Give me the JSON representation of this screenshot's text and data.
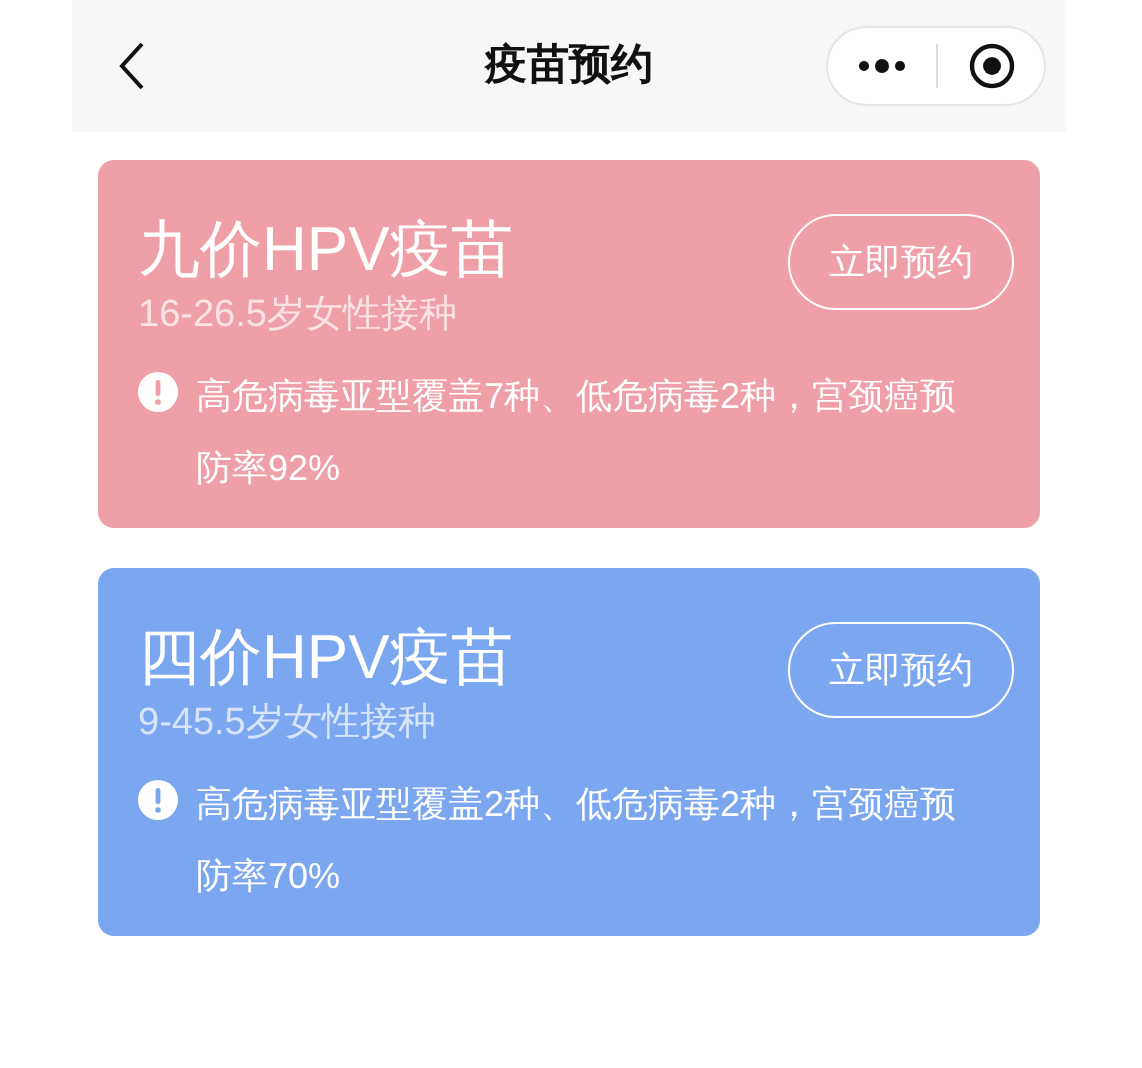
{
  "header": {
    "title": "疫苗预约"
  },
  "vaccines": [
    {
      "name": "九价HPV疫苗",
      "age": "16-26.5岁女性接种",
      "button": "立即预约",
      "note": "高危病毒亚型覆盖7种、低危病毒2种，宫颈癌预防率92%",
      "color": "#ef9fa7"
    },
    {
      "name": "四价HPV疫苗",
      "age": "9-45.5岁女性接种",
      "button": "立即预约",
      "note": "高危病毒亚型覆盖2种、低危病毒2种，宫颈癌预防率70%",
      "color": "#7ba7f0"
    }
  ]
}
